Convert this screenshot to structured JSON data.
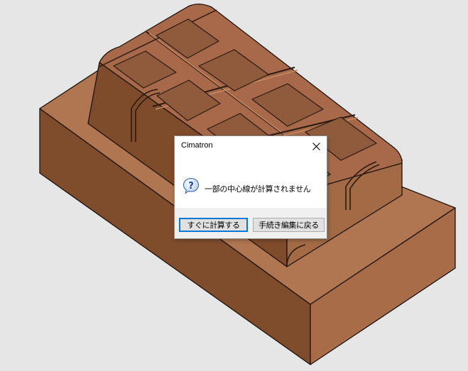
{
  "dialog": {
    "title": "Cimatron",
    "message": "一部の中心線が計算されません",
    "compute_button": "すぐに計算する",
    "back_button": "手続き編集に戻る",
    "icon": "question-icon",
    "close_icon": "close-icon"
  },
  "colors": {
    "background": "#e6e6e6",
    "model_top": "#b07551",
    "model_side_left": "#7f4c2c",
    "model_side_right": "#a86d48",
    "dialog_accent": "#0078d7"
  }
}
